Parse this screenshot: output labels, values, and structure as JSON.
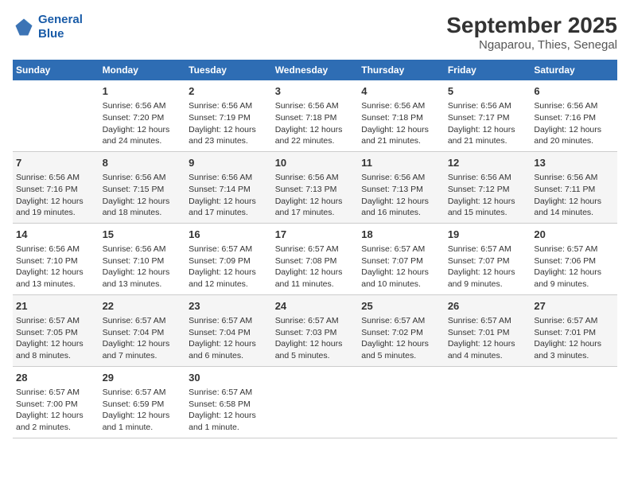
{
  "header": {
    "logo_line1": "General",
    "logo_line2": "Blue",
    "title": "September 2025",
    "subtitle": "Ngaparou, Thies, Senegal"
  },
  "weekdays": [
    "Sunday",
    "Monday",
    "Tuesday",
    "Wednesday",
    "Thursday",
    "Friday",
    "Saturday"
  ],
  "weeks": [
    [
      {
        "day": "",
        "info": ""
      },
      {
        "day": "1",
        "info": "Sunrise: 6:56 AM\nSunset: 7:20 PM\nDaylight: 12 hours\nand 24 minutes."
      },
      {
        "day": "2",
        "info": "Sunrise: 6:56 AM\nSunset: 7:19 PM\nDaylight: 12 hours\nand 23 minutes."
      },
      {
        "day": "3",
        "info": "Sunrise: 6:56 AM\nSunset: 7:18 PM\nDaylight: 12 hours\nand 22 minutes."
      },
      {
        "day": "4",
        "info": "Sunrise: 6:56 AM\nSunset: 7:18 PM\nDaylight: 12 hours\nand 21 minutes."
      },
      {
        "day": "5",
        "info": "Sunrise: 6:56 AM\nSunset: 7:17 PM\nDaylight: 12 hours\nand 21 minutes."
      },
      {
        "day": "6",
        "info": "Sunrise: 6:56 AM\nSunset: 7:16 PM\nDaylight: 12 hours\nand 20 minutes."
      }
    ],
    [
      {
        "day": "7",
        "info": "Sunrise: 6:56 AM\nSunset: 7:16 PM\nDaylight: 12 hours\nand 19 minutes."
      },
      {
        "day": "8",
        "info": "Sunrise: 6:56 AM\nSunset: 7:15 PM\nDaylight: 12 hours\nand 18 minutes."
      },
      {
        "day": "9",
        "info": "Sunrise: 6:56 AM\nSunset: 7:14 PM\nDaylight: 12 hours\nand 17 minutes."
      },
      {
        "day": "10",
        "info": "Sunrise: 6:56 AM\nSunset: 7:13 PM\nDaylight: 12 hours\nand 17 minutes."
      },
      {
        "day": "11",
        "info": "Sunrise: 6:56 AM\nSunset: 7:13 PM\nDaylight: 12 hours\nand 16 minutes."
      },
      {
        "day": "12",
        "info": "Sunrise: 6:56 AM\nSunset: 7:12 PM\nDaylight: 12 hours\nand 15 minutes."
      },
      {
        "day": "13",
        "info": "Sunrise: 6:56 AM\nSunset: 7:11 PM\nDaylight: 12 hours\nand 14 minutes."
      }
    ],
    [
      {
        "day": "14",
        "info": "Sunrise: 6:56 AM\nSunset: 7:10 PM\nDaylight: 12 hours\nand 13 minutes."
      },
      {
        "day": "15",
        "info": "Sunrise: 6:56 AM\nSunset: 7:10 PM\nDaylight: 12 hours\nand 13 minutes."
      },
      {
        "day": "16",
        "info": "Sunrise: 6:57 AM\nSunset: 7:09 PM\nDaylight: 12 hours\nand 12 minutes."
      },
      {
        "day": "17",
        "info": "Sunrise: 6:57 AM\nSunset: 7:08 PM\nDaylight: 12 hours\nand 11 minutes."
      },
      {
        "day": "18",
        "info": "Sunrise: 6:57 AM\nSunset: 7:07 PM\nDaylight: 12 hours\nand 10 minutes."
      },
      {
        "day": "19",
        "info": "Sunrise: 6:57 AM\nSunset: 7:07 PM\nDaylight: 12 hours\nand 9 minutes."
      },
      {
        "day": "20",
        "info": "Sunrise: 6:57 AM\nSunset: 7:06 PM\nDaylight: 12 hours\nand 9 minutes."
      }
    ],
    [
      {
        "day": "21",
        "info": "Sunrise: 6:57 AM\nSunset: 7:05 PM\nDaylight: 12 hours\nand 8 minutes."
      },
      {
        "day": "22",
        "info": "Sunrise: 6:57 AM\nSunset: 7:04 PM\nDaylight: 12 hours\nand 7 minutes."
      },
      {
        "day": "23",
        "info": "Sunrise: 6:57 AM\nSunset: 7:04 PM\nDaylight: 12 hours\nand 6 minutes."
      },
      {
        "day": "24",
        "info": "Sunrise: 6:57 AM\nSunset: 7:03 PM\nDaylight: 12 hours\nand 5 minutes."
      },
      {
        "day": "25",
        "info": "Sunrise: 6:57 AM\nSunset: 7:02 PM\nDaylight: 12 hours\nand 5 minutes."
      },
      {
        "day": "26",
        "info": "Sunrise: 6:57 AM\nSunset: 7:01 PM\nDaylight: 12 hours\nand 4 minutes."
      },
      {
        "day": "27",
        "info": "Sunrise: 6:57 AM\nSunset: 7:01 PM\nDaylight: 12 hours\nand 3 minutes."
      }
    ],
    [
      {
        "day": "28",
        "info": "Sunrise: 6:57 AM\nSunset: 7:00 PM\nDaylight: 12 hours\nand 2 minutes."
      },
      {
        "day": "29",
        "info": "Sunrise: 6:57 AM\nSunset: 6:59 PM\nDaylight: 12 hours\nand 1 minute."
      },
      {
        "day": "30",
        "info": "Sunrise: 6:57 AM\nSunset: 6:58 PM\nDaylight: 12 hours\nand 1 minute."
      },
      {
        "day": "",
        "info": ""
      },
      {
        "day": "",
        "info": ""
      },
      {
        "day": "",
        "info": ""
      },
      {
        "day": "",
        "info": ""
      }
    ]
  ]
}
